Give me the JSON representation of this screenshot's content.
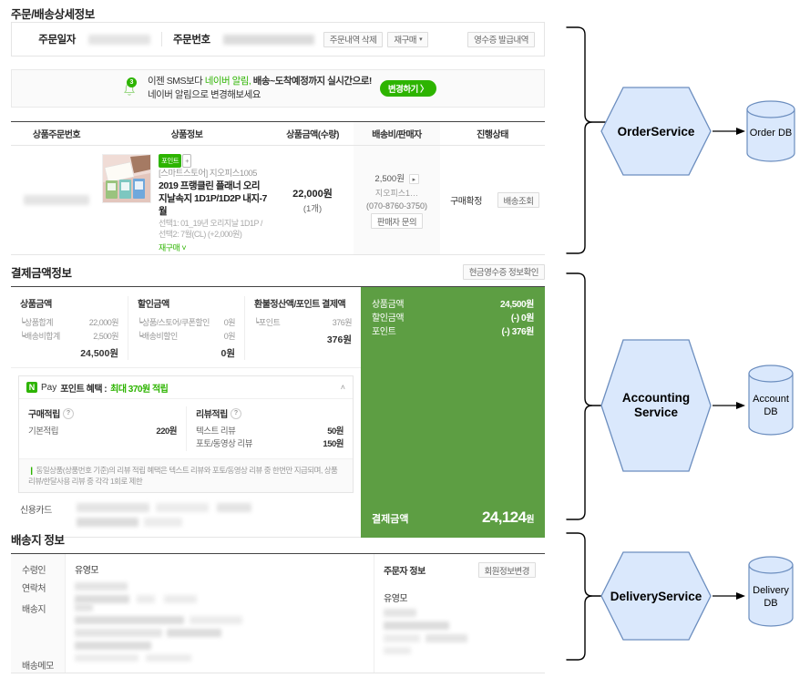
{
  "order_detail": {
    "section_title": "주문/배송상세정보",
    "header": {
      "order_date_label": "주문일자",
      "order_no_label": "주문번호",
      "delete_button": "주문내역 삭제",
      "rebuy_button": "재구매",
      "rebuy_caret": "▾",
      "receipt_button": "영수증 발급내역"
    },
    "notice": {
      "badge_count": "3",
      "line1_a": "이젠 SMS보다 ",
      "line1_b": "네이버 알림,",
      "line1_c": " 배송~도착예정까지 실시간으로!",
      "line2": "네이버 알림으로 변경해보세요",
      "cta": "변경하기 〉"
    },
    "table": {
      "headers": [
        "상품주문번호",
        "상품정보",
        "상품금액(수량)",
        "배송비/판매자",
        "진행상태"
      ],
      "row": {
        "badge": "포인트",
        "badge_plus": "+",
        "store": "[스마트스토어] 지오피스1005",
        "name": "2019 프랭클린 플래너 오리지날속지 1D1P/1D2P 내지-7월",
        "option": "선택1: 01_19년 오리지날 1D1P / 선택2: 7월(CL) (+2,000원)",
        "rebuy_link": "재구매 ˅",
        "price": "22,000원",
        "qty": "(1개)",
        "shipping_fee": "2,500원",
        "seller": "지오피스1…",
        "seller_tel": "(070-8760-3750)",
        "seller_inquiry_button": "판매자 문의",
        "status": "구매확정",
        "track_button": "배송조회"
      }
    }
  },
  "payment": {
    "section_title": "결제금액정보",
    "cash_receipt_button": "현금영수증 정보확인",
    "product_amount": {
      "title": "상품금액",
      "rows": [
        {
          "label": "┕상품합계",
          "value": "22,000원"
        },
        {
          "label": "┕배송비합계",
          "value": "2,500원"
        }
      ],
      "total": "24,500원"
    },
    "discount_amount": {
      "title": "할인금액",
      "rows": [
        {
          "label": "┕상품/스토어/쿠폰할인",
          "value": "0원"
        },
        {
          "label": "┕배송비할인",
          "value": "0원"
        }
      ],
      "total": "0원"
    },
    "refund_point": {
      "title": "환불정산액/포인트 결제액",
      "rows": [
        {
          "label": "┕포인트",
          "value": "376원"
        }
      ],
      "total": "376원"
    },
    "npay": {
      "logo": "N",
      "pay_text": "Pay",
      "title": "포인트 혜택 :",
      "highlight": "최대 370원 적립",
      "collapse_icon": "˄",
      "purchase": {
        "title": "구매적립",
        "help": "?",
        "rows": [
          {
            "label": "기본적립",
            "value": "220원"
          }
        ]
      },
      "review": {
        "title": "리뷰적립",
        "help": "?",
        "rows": [
          {
            "label": "텍스트 리뷰",
            "value": "50원"
          },
          {
            "label": "포토/동영상 리뷰",
            "value": "150원"
          }
        ]
      },
      "footnote_bar": "❙",
      "footnote": "동일상품(상품번호 기준)의 리뷰 적립 혜택은 텍스트 리뷰와 포토/동영상 리뷰 중 한번만 지급되며, 상품리뷰/한달사용 리뷰 중 각각 1회로 제한"
    },
    "card_label": "신용카드",
    "summary": {
      "rows": [
        {
          "label": "상품금액",
          "value": "24,500원"
        },
        {
          "label": "할인금액",
          "value": "(-) 0원"
        },
        {
          "label": "포인트",
          "value": "(-) 376원"
        }
      ],
      "total_label": "결제금액",
      "total_value": "24,124",
      "total_unit": "원"
    }
  },
  "delivery": {
    "section_title": "배송지 정보",
    "labels": [
      "수령인",
      "연락처",
      "배송지",
      "배송메모"
    ],
    "recipient_name": "유영모",
    "orderer": {
      "title": "주문자 정보",
      "edit_button": "회원정보변경",
      "name": "유영모"
    }
  },
  "diagram": {
    "colors": {
      "hex_fill": "#dae8fc",
      "hex_stroke": "#6c8ebf",
      "db_fill": "#dae8fc",
      "db_stroke": "#6c8ebf",
      "arrow": "#000000",
      "brace": "#000000"
    },
    "nodes": [
      {
        "service": "OrderService",
        "db": "Order DB",
        "db_line2": ""
      },
      {
        "service_line1": "Accounting",
        "service_line2": "Service",
        "db": "Account",
        "db_line2": "DB"
      },
      {
        "service": "DeliveryService",
        "db": "Delivery",
        "db_line2": "DB"
      }
    ]
  }
}
